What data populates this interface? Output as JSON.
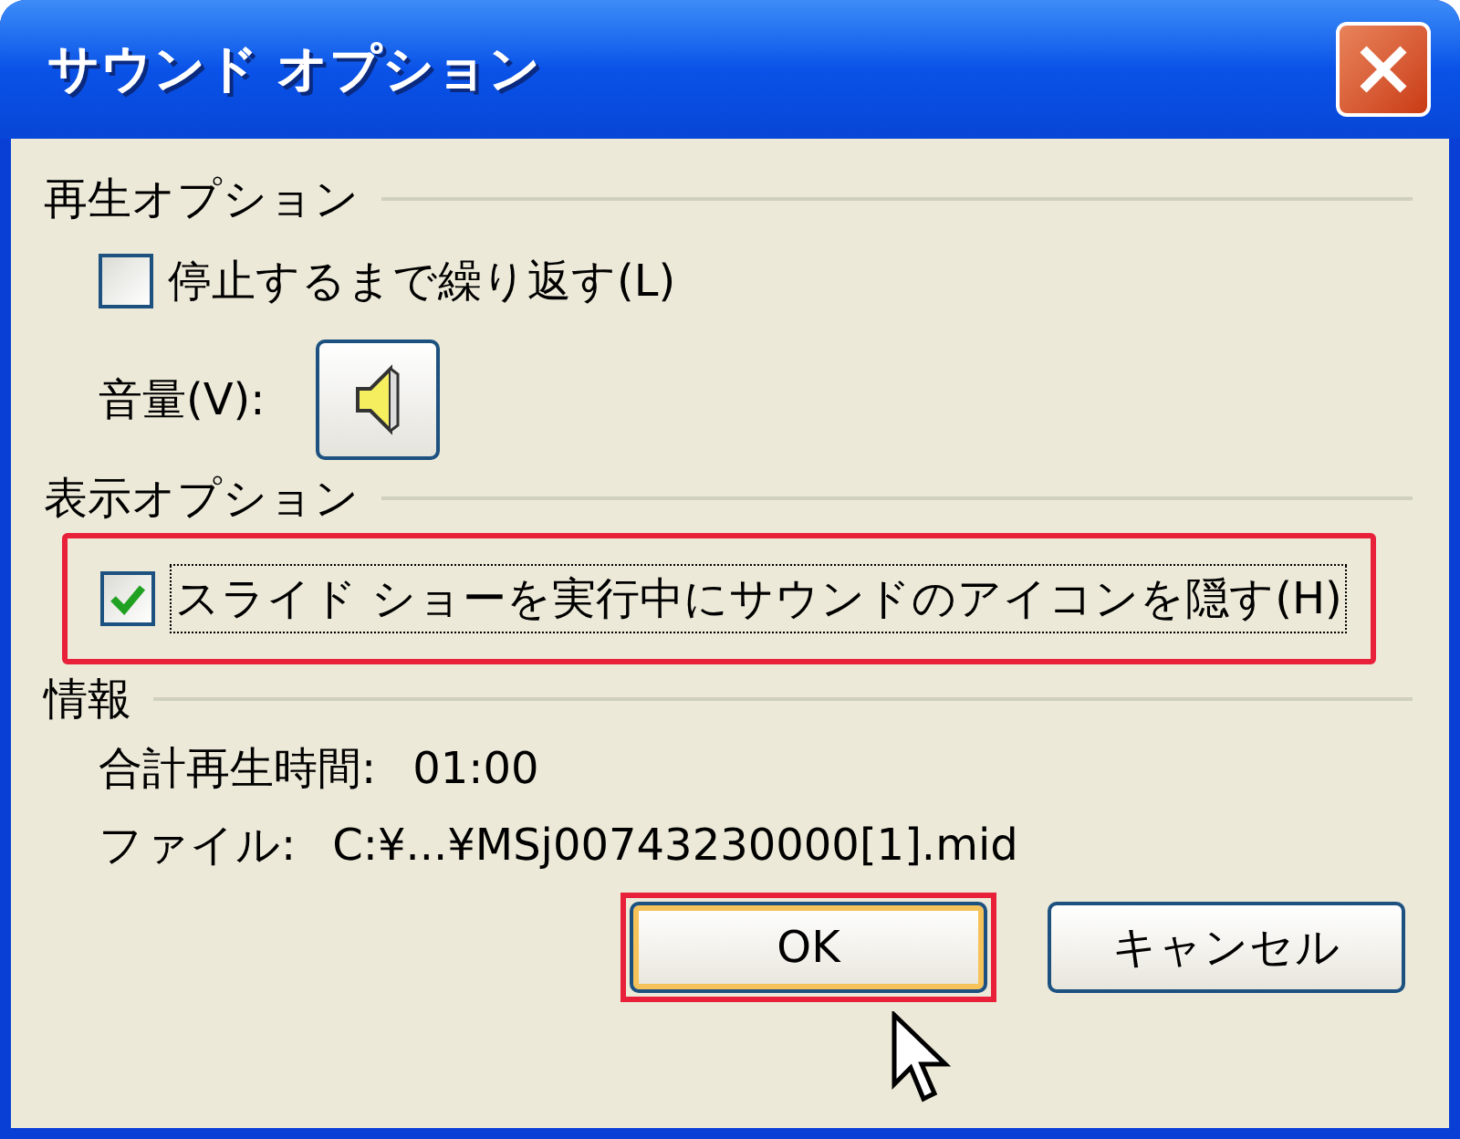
{
  "window": {
    "title": "サウンド オプション"
  },
  "sections": [
    {
      "heading": "再生オプション",
      "items": [
        {
          "kind": "checkbox",
          "label": "停止するまで繰り返す(L)",
          "checked": false,
          "highlighted": false
        },
        {
          "kind": "volume",
          "label": "音量(V):"
        }
      ]
    },
    {
      "heading": "表示オプション",
      "items": [
        {
          "kind": "checkbox",
          "label": "スライド ショーを実行中にサウンドのアイコンを隠す(H)",
          "checked": true,
          "highlighted": true
        }
      ]
    },
    {
      "heading": "情報",
      "items": [
        {
          "kind": "info",
          "label": "合計再生時間:",
          "value": "01:00"
        },
        {
          "kind": "info",
          "label": "ファイル:",
          "value": "C:¥...¥MSj00743230000[1].mid"
        }
      ]
    }
  ],
  "buttons": [
    {
      "label": "OK",
      "default": true,
      "highlighted": true
    },
    {
      "label": "キャンセル",
      "default": false,
      "highlighted": false
    }
  ]
}
